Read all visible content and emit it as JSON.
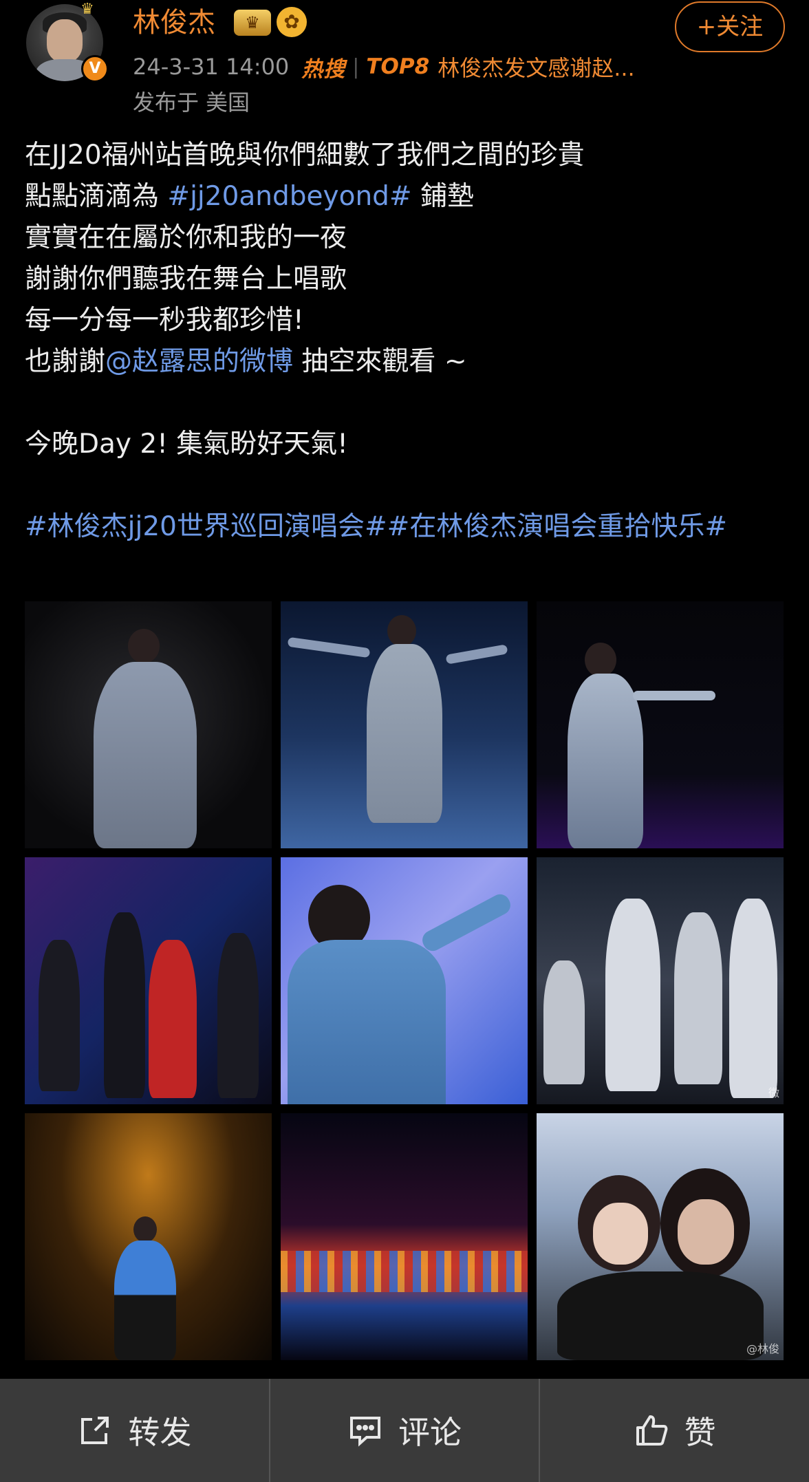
{
  "header": {
    "username": "林俊杰",
    "crown_badge_icon": "crown-icon",
    "flower_badge_icon": "flower-icon",
    "verified_icon": "verified-v-icon",
    "verified_glyph": "V",
    "follow_label": "+关注",
    "timestamp": "24-3-31 14:00",
    "hot_search_logo": "热搜",
    "hot_rank": "TOP8",
    "hot_topic": "林俊杰发文感谢赵...",
    "location_label": "发布于",
    "location_value": "美国"
  },
  "post": {
    "line1": "在JJ20福州站首晚與你們細數了我們之間的珍貴",
    "line2_prefix": "點點滴滴為 ",
    "line2_tag": "#jj20andbeyond#",
    "line2_suffix": " 鋪墊",
    "line3": "實實在在屬於你和我的一夜",
    "line4": "謝謝你們聽我在舞台上唱歌",
    "line5": "每一分每一秒我都珍惜!",
    "line6_prefix": "也謝謝",
    "line6_mention": "@赵露思的微博",
    "line6_suffix": " 抽空來觀看 ~",
    "line7": "今晚Day 2!  集氣盼好天氣!",
    "tags": "#林俊杰jj20世界巡回演唱会##在林俊杰演唱会重拾快乐#"
  },
  "images": {
    "watermark_6": "微",
    "watermark_9": "@林俊"
  },
  "actions": {
    "repost_label": "转发",
    "repost_icon": "share-icon",
    "comment_label": "评论",
    "comment_icon": "comment-icon",
    "like_label": "赞",
    "like_icon": "thumbs-up-icon"
  },
  "colors": {
    "accent_orange": "#f08a33",
    "link_blue": "#6f9ae6",
    "background": "#000000",
    "action_bar": "#3a3a3a"
  }
}
